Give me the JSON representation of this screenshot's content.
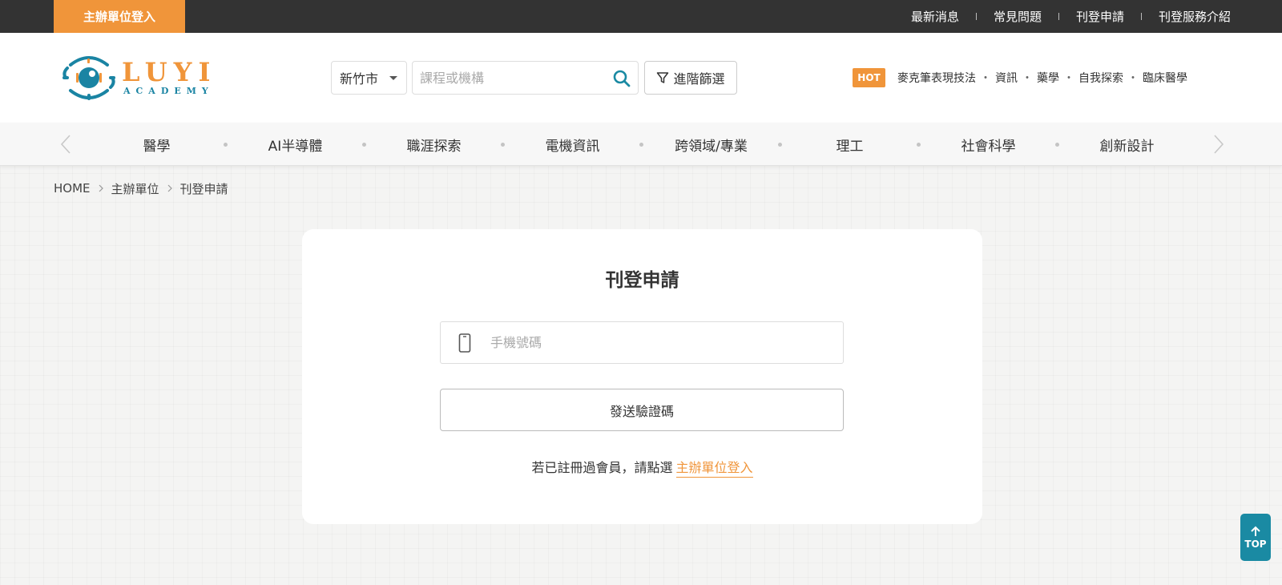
{
  "topbar": {
    "org_login": "主辦單位登入",
    "nav": [
      "最新消息",
      "常見問題",
      "刊登申請",
      "刊登服務介紹"
    ]
  },
  "header": {
    "logo_word": "LUYI",
    "logo_sub": "ACADEMY",
    "city": "新竹市",
    "search_placeholder": "課程或機構",
    "advanced_filter": "進階篩選",
    "hot_badge": "HOT",
    "hot_keywords": [
      "麥克筆表現技法",
      "資訊",
      "藥學",
      "自我探索",
      "臨床醫學"
    ],
    "hot_separator": "・"
  },
  "categories": [
    "醫學",
    "AI半導體",
    "職涯探索",
    "電機資訊",
    "跨領域/專業",
    "理工",
    "社會科學",
    "創新設計"
  ],
  "breadcrumb": [
    "HOME",
    "主辦單位",
    "刊登申請"
  ],
  "form": {
    "title": "刊登申請",
    "phone_placeholder": "手機號碼",
    "send_code": "發送驗證碼",
    "hint": "若已註冊過會員，請點選",
    "hint_link": "主辦單位登入"
  },
  "to_top": "TOP",
  "colors": {
    "accent_orange": "#f0953a",
    "brand_teal": "#1a8aa3",
    "topbar": "#333333"
  }
}
